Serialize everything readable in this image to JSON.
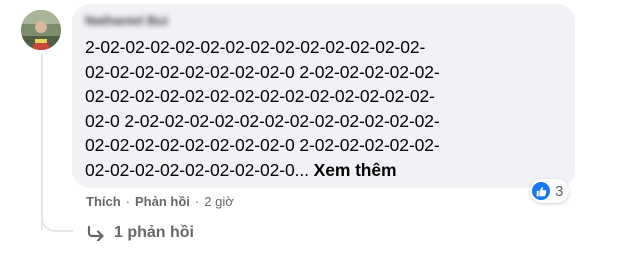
{
  "comment": {
    "author_name": "Nathaniel Bui",
    "text_lines": [
      "2-02-02-02-02-02-02-02-02-02-02-02-02-02-",
      "02-02-02-02-02-02-02-02-0 2-02-02-02-02-02-",
      "02-02-02-02-02-02-02-02-02-02-02-02-02-02-",
      "02-0 2-02-02-02-02-02-02-02-02-02-02-02-02-",
      "02-02-02-02-02-02-02-02-0 2-02-02-02-02-02-",
      "02-02-02-02-02-02-02-02-0..."
    ],
    "see_more_label": "Xem thêm",
    "reaction_count": "3",
    "reaction_icon": "like-icon"
  },
  "actions": {
    "like_label": "Thích",
    "separator": "·",
    "reply_label": "Phản hồi",
    "timestamp": "2 giờ"
  },
  "replies": {
    "label": "1 phản hồi",
    "icon": "reply-arrow-icon"
  },
  "colors": {
    "bubble_bg": "#f0f2f5",
    "text": "#050505",
    "secondary_text": "#65676b",
    "like_blue": "#1877f2"
  }
}
